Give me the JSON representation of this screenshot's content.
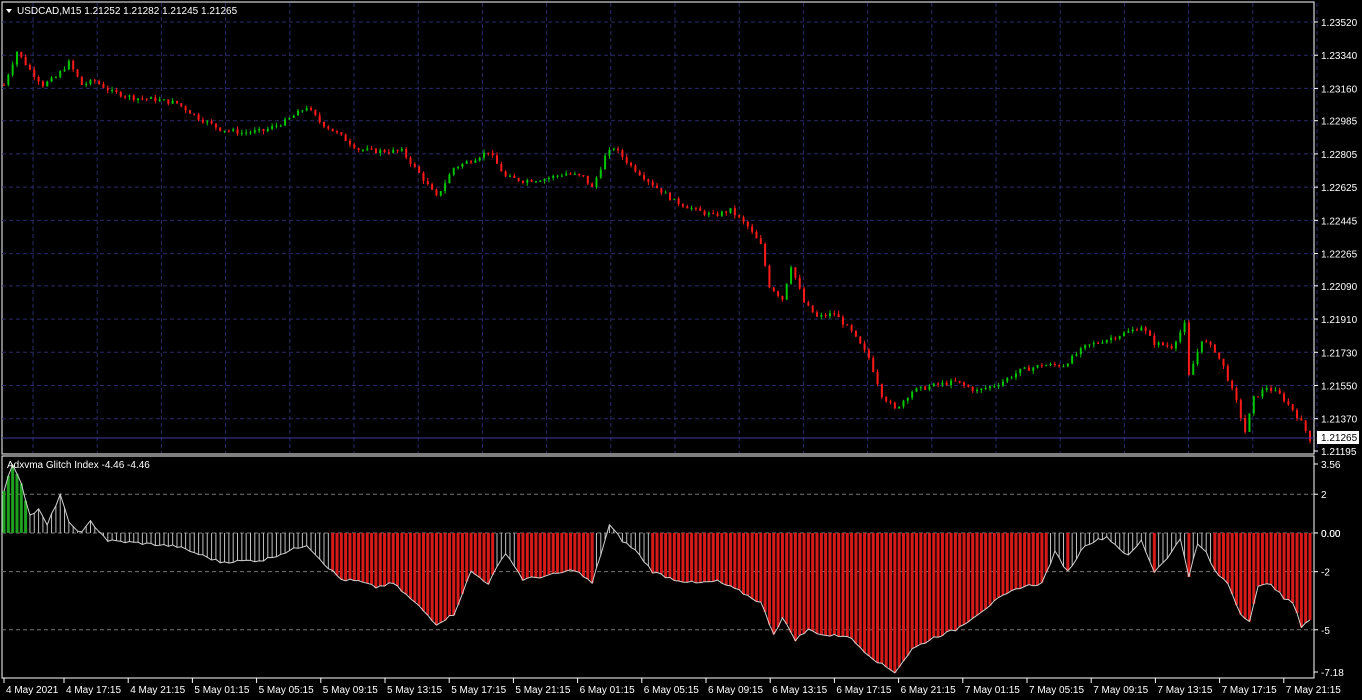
{
  "main_chart": {
    "symbol_line": "USDCAD,M15  1.21252 1.21282 1.21245 1.21265",
    "price_ticks": [
      "1.23520",
      "1.23340",
      "1.23160",
      "1.22985",
      "1.22805",
      "1.22625",
      "1.22445",
      "1.22265",
      "1.22090",
      "1.21910",
      "1.21730",
      "1.21550",
      "1.21370",
      "1.21195"
    ],
    "current_price_label": "1.21265",
    "up_color": "#00c800",
    "down_color": "#ff1a1a",
    "grid_color": "#2a2a6a"
  },
  "indicator": {
    "title": "Adxvma Glitch Index -4.46 -4.46",
    "ticks": [
      "3.56",
      "2",
      "0.00",
      "0.00",
      "-2",
      "-5",
      "-7.18"
    ],
    "positive_color": "#20a020",
    "negative_color": "#d61a1a",
    "neutral_color": "#c0c0c0"
  },
  "time_axis": {
    "labels": [
      "4 May 2021",
      "4 May 17:15",
      "4 May 21:15",
      "5 May 01:15",
      "5 May 05:15",
      "5 May 09:15",
      "5 May 13:15",
      "5 May 17:15",
      "5 May 21:15",
      "6 May 01:15",
      "6 May 05:15",
      "6 May 09:15",
      "6 May 13:15",
      "6 May 17:15",
      "6 May 21:15",
      "7 May 01:15",
      "7 May 05:15",
      "7 May 09:15",
      "7 May 13:15",
      "7 May 17:15",
      "7 May 21:15"
    ]
  },
  "chart_data": {
    "type": "candlestick",
    "symbol": "USDCAD",
    "timeframe": "M15",
    "ohlc_last": {
      "open": 1.21252,
      "high": 1.21282,
      "low": 1.21245,
      "close": 1.21265
    },
    "price_path": [
      [
        0,
        1.2318
      ],
      [
        3,
        1.2336
      ],
      [
        6,
        1.2326
      ],
      [
        9,
        1.2318
      ],
      [
        12,
        1.2322
      ],
      [
        15,
        1.233
      ],
      [
        18,
        1.2318
      ],
      [
        21,
        1.232
      ],
      [
        25,
        1.2314
      ],
      [
        30,
        1.2311
      ],
      [
        35,
        1.231
      ],
      [
        40,
        1.2308
      ],
      [
        45,
        1.23
      ],
      [
        50,
        1.2294
      ],
      [
        55,
        1.2292
      ],
      [
        60,
        1.2293
      ],
      [
        65,
        1.2298
      ],
      [
        70,
        1.2306
      ],
      [
        73,
        1.2298
      ],
      [
        78,
        1.229
      ],
      [
        82,
        1.2283
      ],
      [
        86,
        1.2282
      ],
      [
        92,
        1.2282
      ],
      [
        96,
        1.227
      ],
      [
        100,
        1.2257
      ],
      [
        104,
        1.2273
      ],
      [
        108,
        1.2277
      ],
      [
        112,
        1.2282
      ],
      [
        116,
        1.2268
      ],
      [
        120,
        1.2266
      ],
      [
        125,
        1.2267
      ],
      [
        130,
        1.227
      ],
      [
        134,
        1.2268
      ],
      [
        136,
        1.2262
      ],
      [
        139,
        1.2279
      ],
      [
        141,
        1.2284
      ],
      [
        145,
        1.2274
      ],
      [
        150,
        1.2264
      ],
      [
        155,
        1.2255
      ],
      [
        160,
        1.225
      ],
      [
        164,
        1.2247
      ],
      [
        168,
        1.225
      ],
      [
        172,
        1.2241
      ],
      [
        175,
        1.2231
      ],
      [
        177,
        1.2209
      ],
      [
        180,
        1.2202
      ],
      [
        182,
        1.222
      ],
      [
        185,
        1.22
      ],
      [
        188,
        1.2192
      ],
      [
        192,
        1.2194
      ],
      [
        196,
        1.2184
      ],
      [
        200,
        1.217
      ],
      [
        203,
        1.215
      ],
      [
        206,
        1.2142
      ],
      [
        210,
        1.2152
      ],
      [
        215,
        1.2155
      ],
      [
        220,
        1.2157
      ],
      [
        225,
        1.2152
      ],
      [
        230,
        1.2156
      ],
      [
        235,
        1.2163
      ],
      [
        240,
        1.2166
      ],
      [
        245,
        1.2166
      ],
      [
        250,
        1.2176
      ],
      [
        255,
        1.218
      ],
      [
        260,
        1.2184
      ],
      [
        263,
        1.2187
      ],
      [
        266,
        1.2178
      ],
      [
        270,
        1.2176
      ],
      [
        273,
        1.2188
      ],
      [
        274,
        1.216
      ],
      [
        277,
        1.218
      ],
      [
        280,
        1.2174
      ],
      [
        282,
        1.2165
      ],
      [
        285,
        1.2146
      ],
      [
        287,
        1.213
      ],
      [
        289,
        1.2148
      ],
      [
        292,
        1.2154
      ],
      [
        295,
        1.215
      ],
      [
        298,
        1.2142
      ],
      [
        300,
        1.2135
      ],
      [
        302,
        1.2126
      ]
    ],
    "indicator_values": [
      [
        0,
        2.2
      ],
      [
        2,
        3.56
      ],
      [
        4,
        2.6
      ],
      [
        6,
        0.9
      ],
      [
        8,
        1.2
      ],
      [
        10,
        0.4
      ],
      [
        13,
        2.0
      ],
      [
        15,
        0.5
      ],
      [
        18,
        0.0
      ],
      [
        20,
        0.6
      ],
      [
        24,
        -0.4
      ],
      [
        30,
        -0.5
      ],
      [
        40,
        -0.7
      ],
      [
        50,
        -1.5
      ],
      [
        60,
        -1.4
      ],
      [
        70,
        -0.6
      ],
      [
        75,
        -1.8
      ],
      [
        78,
        -2.4
      ],
      [
        82,
        -2.5
      ],
      [
        86,
        -2.8
      ],
      [
        90,
        -2.6
      ],
      [
        96,
        -3.8
      ],
      [
        100,
        -4.7
      ],
      [
        104,
        -4.2
      ],
      [
        108,
        -2.0
      ],
      [
        112,
        -2.6
      ],
      [
        116,
        -1.0
      ],
      [
        120,
        -2.4
      ],
      [
        126,
        -2.2
      ],
      [
        132,
        -1.9
      ],
      [
        136,
        -2.6
      ],
      [
        140,
        0.4
      ],
      [
        143,
        -0.4
      ],
      [
        146,
        -0.9
      ],
      [
        150,
        -2.0
      ],
      [
        155,
        -2.4
      ],
      [
        160,
        -2.6
      ],
      [
        165,
        -2.5
      ],
      [
        170,
        -3.0
      ],
      [
        175,
        -3.6
      ],
      [
        178,
        -5.2
      ],
      [
        180,
        -4.4
      ],
      [
        183,
        -5.5
      ],
      [
        186,
        -5.0
      ],
      [
        190,
        -5.3
      ],
      [
        195,
        -5.3
      ],
      [
        200,
        -6.3
      ],
      [
        203,
        -6.8
      ],
      [
        206,
        -7.18
      ],
      [
        210,
        -6.0
      ],
      [
        215,
        -5.4
      ],
      [
        220,
        -5.0
      ],
      [
        225,
        -4.2
      ],
      [
        230,
        -3.4
      ],
      [
        235,
        -2.8
      ],
      [
        240,
        -2.6
      ],
      [
        243,
        -1.0
      ],
      [
        246,
        -2.0
      ],
      [
        250,
        -0.6
      ],
      [
        255,
        -0.2
      ],
      [
        260,
        -1.2
      ],
      [
        263,
        -0.4
      ],
      [
        266,
        -2.0
      ],
      [
        270,
        -1.0
      ],
      [
        272,
        -0.3
      ],
      [
        274,
        -2.2
      ],
      [
        276,
        -0.6
      ],
      [
        278,
        -1.0
      ],
      [
        280,
        -2.0
      ],
      [
        283,
        -2.6
      ],
      [
        286,
        -4.2
      ],
      [
        288,
        -4.5
      ],
      [
        290,
        -2.8
      ],
      [
        293,
        -2.6
      ],
      [
        296,
        -3.4
      ],
      [
        298,
        -3.6
      ],
      [
        300,
        -4.8
      ],
      [
        302,
        -4.46
      ]
    ],
    "price_range": [
      1.21195,
      1.2352
    ],
    "indicator_range": [
      -7.18,
      3.56
    ]
  }
}
